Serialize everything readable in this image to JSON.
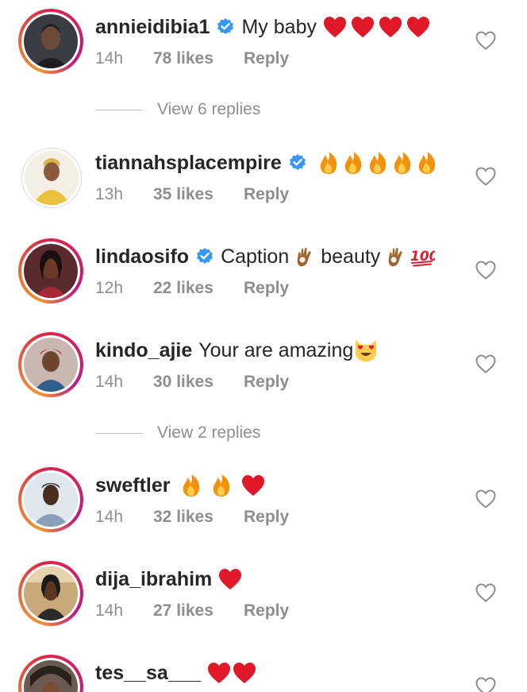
{
  "colors": {
    "text": "#262626",
    "secondary": "#8e8e8e",
    "verified": "#3897f0",
    "heart": "#ed1c24",
    "background": "#ffffff"
  },
  "comments": [
    {
      "username": "annieidibia1",
      "verified": true,
      "text": "My baby",
      "emojis": [
        "heart",
        "heart",
        "heart",
        "heart"
      ],
      "time": "14h",
      "likes": "78 likes",
      "reply": "Reply",
      "view_replies": "View 6 replies"
    },
    {
      "username": "tiannahsplacempire",
      "verified": true,
      "text": "",
      "emojis": [
        "fire",
        "fire",
        "fire",
        "fire",
        "fire"
      ],
      "time": "13h",
      "likes": "35 likes",
      "reply": "Reply"
    },
    {
      "username": "lindaosifo",
      "verified": true,
      "text": "Caption",
      "text2": "beauty",
      "emojis_mid": [
        "ok-hand"
      ],
      "emojis": [
        "ok-hand",
        "hundred"
      ],
      "time": "12h",
      "likes": "22 likes",
      "reply": "Reply"
    },
    {
      "username": "kindo_ajie",
      "verified": false,
      "text": "Your are amazing",
      "emojis": [
        "heart-eyes-cat"
      ],
      "time": "14h",
      "likes": "30 likes",
      "reply": "Reply",
      "view_replies": "View 2 replies"
    },
    {
      "username": "sweftler",
      "verified": false,
      "text": "",
      "emojis": [
        "fire",
        "fire",
        "heart"
      ],
      "time": "14h",
      "likes": "32 likes",
      "reply": "Reply"
    },
    {
      "username": "dija_ibrahim",
      "verified": false,
      "text": "",
      "emojis": [
        "heart"
      ],
      "time": "14h",
      "likes": "27 likes",
      "reply": "Reply"
    },
    {
      "username": "tes__sa___",
      "verified": false,
      "text": "",
      "emojis": [
        "heart",
        "heart"
      ]
    }
  ]
}
